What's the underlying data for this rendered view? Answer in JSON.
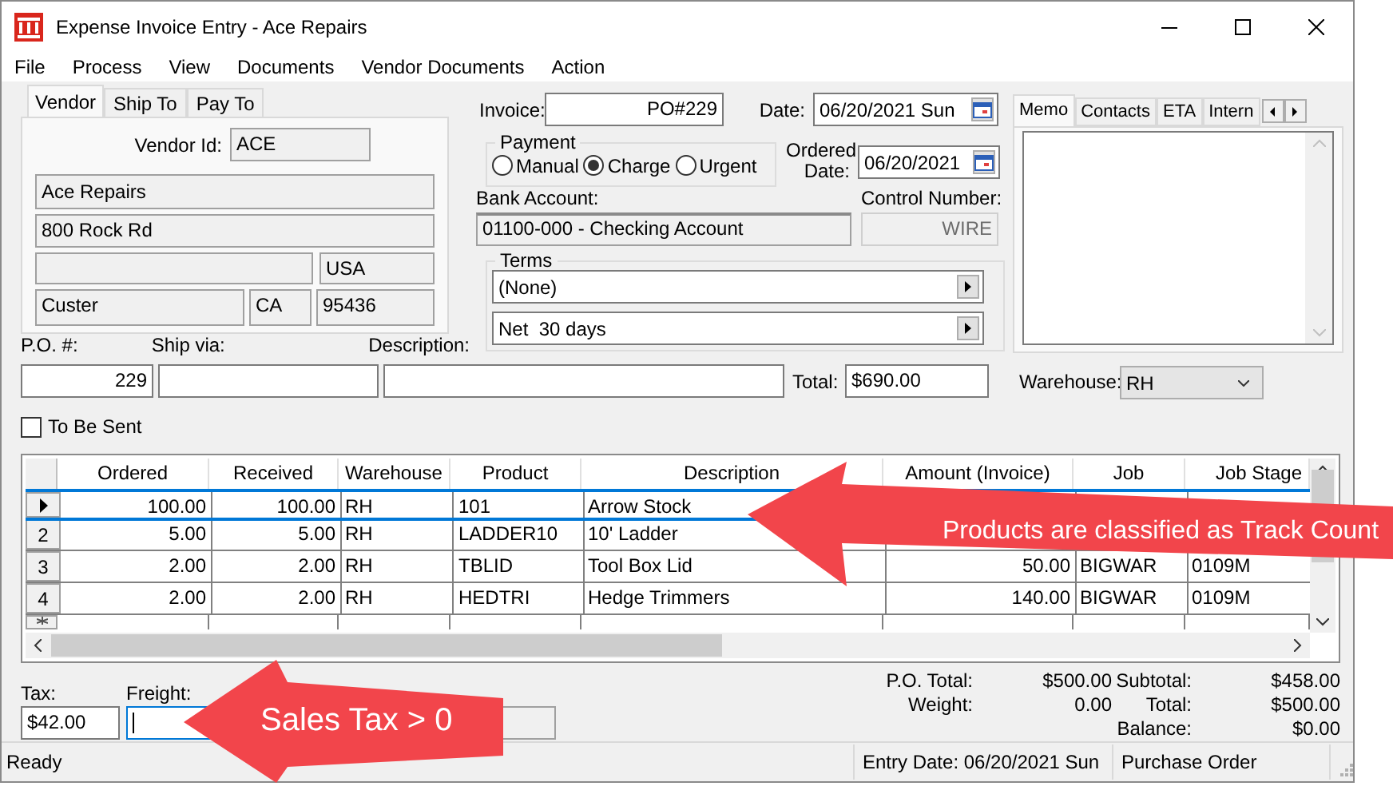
{
  "window": {
    "title": "Expense Invoice Entry - Ace Repairs"
  },
  "menu": [
    "File",
    "Process",
    "View",
    "Documents",
    "Vendor Documents",
    "Action"
  ],
  "vendor_tabs": [
    {
      "label": "Vendor",
      "selected": true
    },
    {
      "label": "Ship To",
      "selected": false
    },
    {
      "label": "Pay To",
      "selected": false
    }
  ],
  "vendor": {
    "id_label": "Vendor Id:",
    "id": "ACE",
    "name": "Ace Repairs",
    "address": "800 Rock Rd",
    "country": "USA",
    "city": "Custer",
    "state": "CA",
    "zip": "95436"
  },
  "invoice": {
    "label": "Invoice:",
    "value": "PO#229",
    "date_label": "Date:",
    "date": "06/20/2021 Sun"
  },
  "payment": {
    "legend": "Payment",
    "options": [
      {
        "label": "Manual",
        "selected": false
      },
      {
        "label": "Charge",
        "selected": true
      },
      {
        "label": "Urgent",
        "selected": false
      }
    ]
  },
  "ordered_date": {
    "label": "Ordered Date:",
    "value": "06/20/2021"
  },
  "bank_account": {
    "label": "Bank Account:",
    "value": "01100-000 - Checking Account"
  },
  "control_number": {
    "label": "Control Number:",
    "value": "WIRE",
    "disabled": true
  },
  "terms": {
    "legend": "Terms",
    "fields": [
      "(None)",
      "Net  30 days"
    ]
  },
  "memo_tabs": [
    {
      "label": "Memo",
      "selected": true
    },
    {
      "label": "Contacts",
      "selected": false
    },
    {
      "label": "ETA",
      "selected": false
    },
    {
      "label": "Intern",
      "selected": false
    }
  ],
  "po": {
    "label": "P.O. #:",
    "value": "229"
  },
  "ship_via": {
    "label": "Ship via:"
  },
  "description": {
    "label": "Description:"
  },
  "total": {
    "label": "Total:",
    "value": "$690.00"
  },
  "warehouse": {
    "label": "Warehouse:",
    "value": "RH"
  },
  "to_be_sent": {
    "label": "To Be Sent",
    "checked": false
  },
  "table": {
    "columns": [
      "Ordered",
      "Received",
      "Warehouse",
      "Product",
      "Description",
      "Amount (Invoice)",
      "Job",
      "Job Stage"
    ],
    "rows": [
      {
        "selected": true,
        "ordered": "100.00",
        "received": "100.00",
        "warehouse": "RH",
        "product": "101",
        "description": "Arrow Stock"
      },
      {
        "selected": false,
        "number": "2",
        "ordered": "5.00",
        "received": "5.00",
        "warehouse": "RH",
        "product": "LADDER10",
        "description": "10' Ladder"
      },
      {
        "selected": false,
        "number": "3",
        "ordered": "2.00",
        "received": "2.00",
        "warehouse": "RH",
        "product": "TBLID",
        "description": "Tool Box Lid",
        "amount": "50.00",
        "job": "BIGWAR",
        "job_stage": "0109M"
      },
      {
        "selected": false,
        "number": "4",
        "ordered": "2.00",
        "received": "2.00",
        "warehouse": "RH",
        "product": "HEDTRI",
        "description": "Hedge Trimmers",
        "amount": "140.00",
        "job": "BIGWAR",
        "job_stage": "0109M"
      }
    ]
  },
  "tax": {
    "label": "Tax:",
    "value": "$42.00"
  },
  "freight": {
    "label": "Freight:",
    "focused": true
  },
  "totals": {
    "left": [
      {
        "label": "P.O. Total:",
        "value": "$500.00"
      },
      {
        "label": "Weight:",
        "value": "0.00"
      }
    ],
    "right": [
      {
        "label": "Subtotal:",
        "value": "$458.00"
      },
      {
        "label": "Total:",
        "value": "$500.00"
      },
      {
        "label": "Balance:",
        "value": "$0.00"
      }
    ]
  },
  "status_bar": [
    "Ready",
    "Entry Date: 06/20/2021 Sun",
    "Purchase Order"
  ],
  "annotations": [
    {
      "text": "Products are classified as Track Count"
    },
    {
      "text": "Sales Tax > 0"
    }
  ]
}
